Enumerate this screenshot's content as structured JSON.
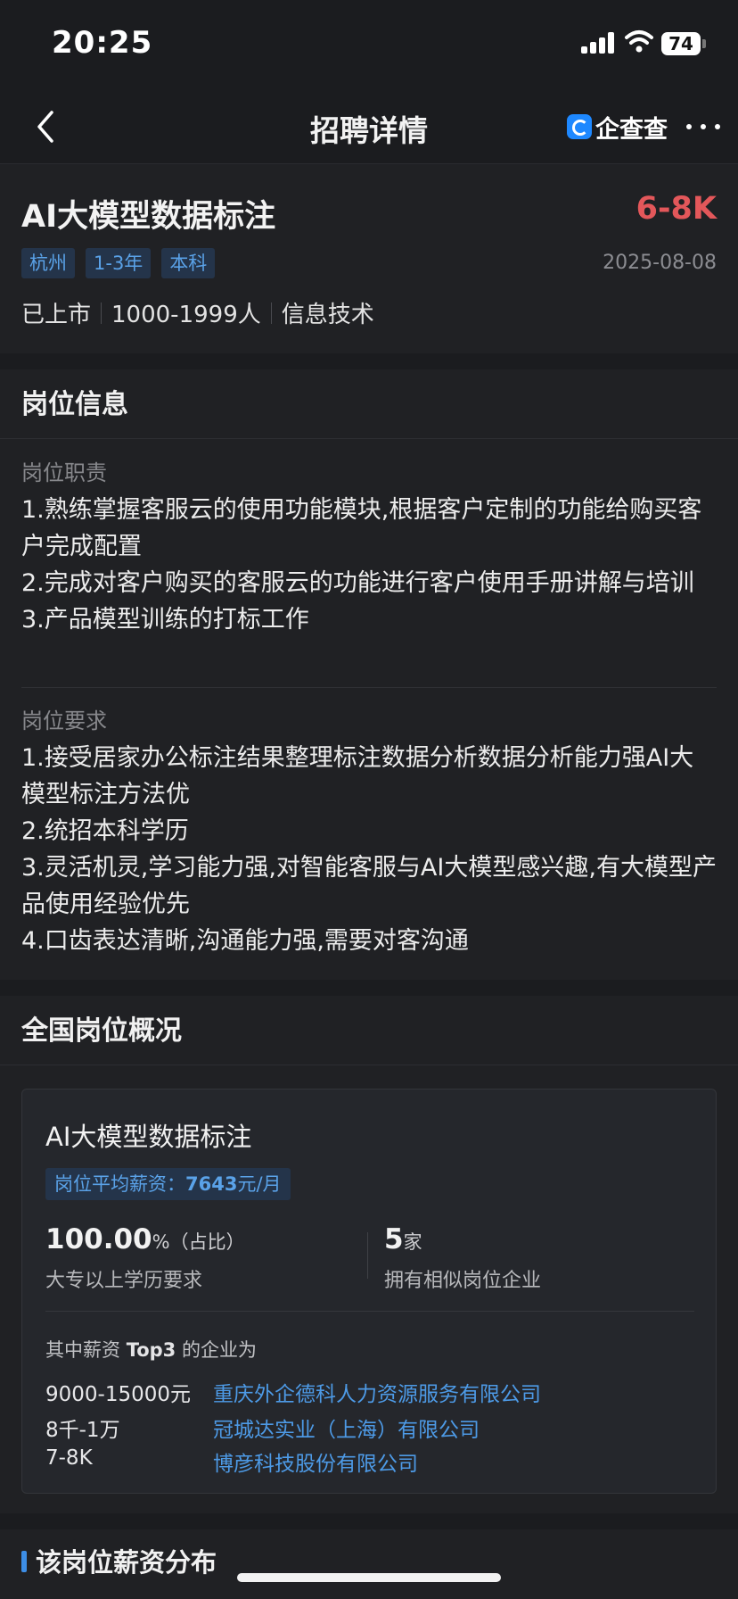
{
  "status_bar": {
    "time": "20:25",
    "battery": "74"
  },
  "nav": {
    "title": "招聘详情",
    "brand": "企查查"
  },
  "job": {
    "title": "AI大模型数据标注",
    "salary": "6-8K",
    "tags": [
      "杭州",
      "1-3年",
      "本科"
    ],
    "date": "2025-08-08",
    "meta": [
      "已上市",
      "1000-1999人",
      "信息技术"
    ]
  },
  "position_info": {
    "header": "岗位信息",
    "duty_label": "岗位职责",
    "duties": [
      "1.熟练掌握客服云的使用功能模块,根据客户定制的功能给购买客户完成配置",
      "2.完成对客户购买的客服云的功能进行客户使用手册讲解与培训",
      "3.产品模型训练的打标工作"
    ],
    "req_label": "岗位要求",
    "requirements": [
      "1.接受居家办公标注结果整理标注数据分析数据分析能力强AI大模型标注方法优",
      "2.统招本科学历",
      "3.灵活机灵,学习能力强,对智能客服与AI大模型感兴趣,有大模型产品使用经验优先",
      "4.口齿表达清晰,沟通能力强,需要对客沟通"
    ]
  },
  "overview": {
    "header": "全国岗位概况",
    "card_title": "AI大模型数据标注",
    "avg_label": "岗位平均薪资：",
    "avg_value": "7643",
    "avg_unit": "元/月",
    "stat1_value": "100.00",
    "stat1_unit": "%（占比）",
    "stat1_label": "大专以上学历要求",
    "stat2_value": "5",
    "stat2_unit": "家",
    "stat2_label": "拥有相似岗位企业",
    "top3_prefix": "其中薪资 ",
    "top3_bold": "Top3",
    "top3_suffix": " 的企业为",
    "top3": [
      {
        "salary": "9000-15000元",
        "company": "重庆外企德科人力资源服务有限公司"
      },
      {
        "salary": "8千-1万",
        "company": "冠城达实业（上海）有限公司"
      },
      {
        "salary": "7-8K",
        "company": "博彦科技股份有限公司"
      }
    ]
  },
  "distribution": {
    "header": "该岗位薪资分布"
  }
}
